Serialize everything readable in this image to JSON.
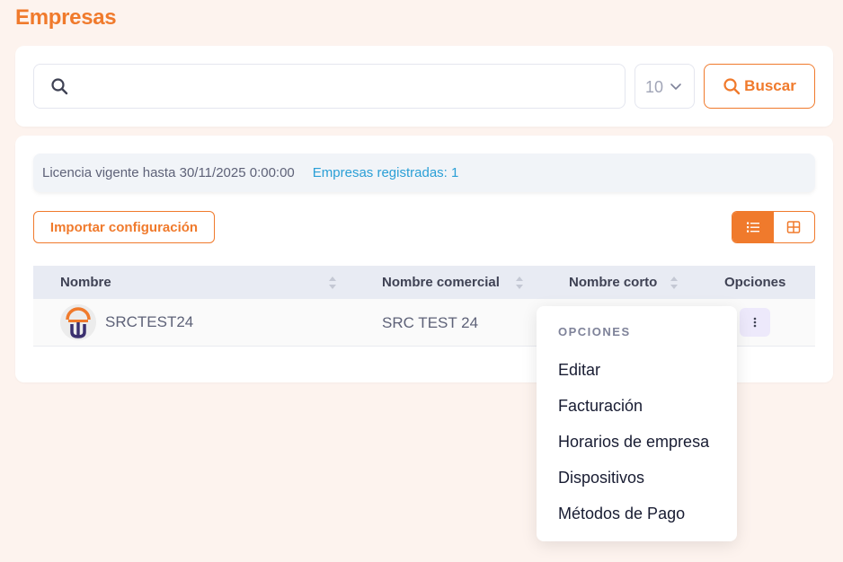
{
  "page": {
    "title": "Empresas"
  },
  "search": {
    "value": "",
    "placeholder": "",
    "page_size": "10",
    "button_label": "Buscar"
  },
  "license": {
    "text": "Licencia vigente hasta 30/11/2025 0:00:00",
    "companies_count": "Empresas registradas: 1"
  },
  "actions": {
    "import_label": "Importar configuración",
    "view_modes": [
      {
        "icon": "list-icon",
        "active": true
      },
      {
        "icon": "grid-icon",
        "active": false
      }
    ]
  },
  "table": {
    "columns": [
      "Nombre",
      "Nombre comercial",
      "Nombre corto",
      "Opciones"
    ],
    "rows": [
      {
        "nombre": "SRCTEST24",
        "nombre_comercial": "SRC TEST 24",
        "nombre_corto": "",
        "options_icon": "more-vertical-icon"
      }
    ]
  },
  "dropdown": {
    "heading": "OPCIONES",
    "items": [
      "Editar",
      "Facturación",
      "Horarios de empresa",
      "Dispositivos",
      "Métodos de Pago"
    ]
  },
  "colors": {
    "accent": "#f07a2c",
    "background": "#fdf3ee",
    "link": "#2a9fd6",
    "header_bg": "#e8ebf3"
  }
}
